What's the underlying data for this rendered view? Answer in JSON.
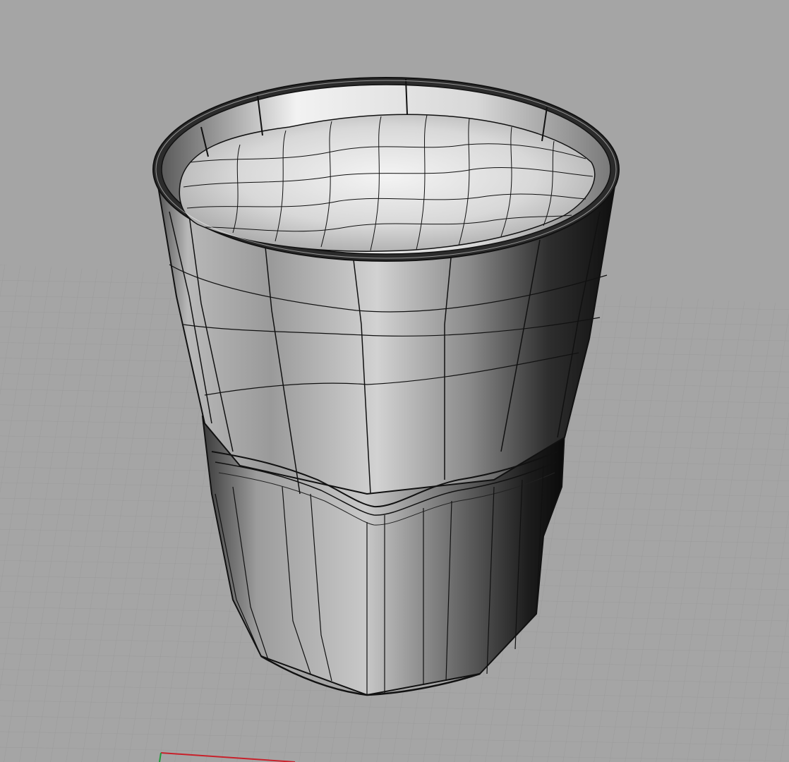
{
  "viewport": {
    "label": "",
    "background_color": "#a5a5a5",
    "grid_line_color": "#9a9a9a",
    "grid_major_color": "#8f8f8f",
    "axis_x_color": "#c8202a",
    "axis_y_color": "#1f9a3a",
    "display_mode": "shaded",
    "object": {
      "name": "",
      "type": "tumbler-glass",
      "sides": 8,
      "contents": "liquid"
    }
  }
}
